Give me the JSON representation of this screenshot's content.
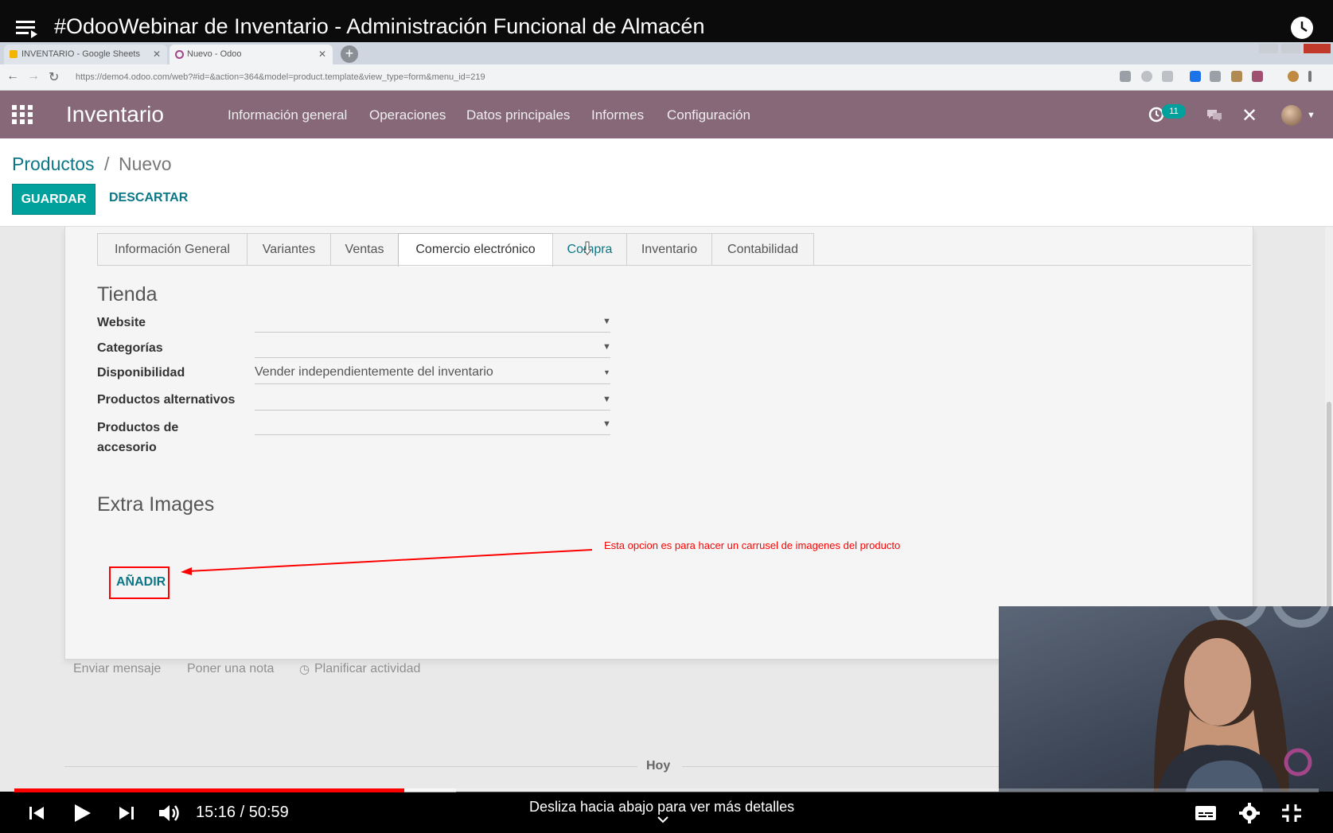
{
  "video": {
    "title": "#OdooWebinar de Inventario - Administración Funcional de Almacén",
    "time_current": "15:16",
    "time_separator": " / ",
    "time_total": "50:59",
    "progress_fraction": 0.299,
    "hint": "Desliza hacia abajo para ver más detalles"
  },
  "browser": {
    "tabs": [
      {
        "label": "INVENTARIO - Google Sheets"
      },
      {
        "label": "Nuevo - Odoo"
      }
    ],
    "url": "https://demo4.odoo.com/web?#id=&action=364&model=product.template&view_type=form&menu_id=219"
  },
  "odoo": {
    "app_name": "Inventario",
    "menu": [
      "Información general",
      "Operaciones",
      "Datos principales",
      "Informes",
      "Configuración"
    ],
    "activity_count": "11",
    "breadcrumb": {
      "parent": "Productos",
      "separator": "/",
      "current": "Nuevo"
    },
    "buttons": {
      "save": "GUARDAR",
      "discard": "DESCARTAR",
      "add": "AÑADIR"
    },
    "tabs": [
      "Información General",
      "Variantes",
      "Ventas",
      "Comercio electrónico",
      "Compra",
      "Inventario",
      "Contabilidad"
    ],
    "active_tab": "Comercio electrónico",
    "shop": {
      "title": "Tienda",
      "fields": [
        {
          "label": "Website",
          "value": ""
        },
        {
          "label": "Categorías",
          "value": ""
        },
        {
          "label": "Disponibilidad",
          "value": "Vender independientemente del inventario"
        },
        {
          "label": "Productos alternativos",
          "value": ""
        },
        {
          "label": "Productos de accesorio",
          "value": ""
        }
      ]
    },
    "extra_images_title": "Extra Images",
    "chatter": {
      "send": "Enviar mensaje",
      "note": "Poner una nota",
      "activity": "Planificar actividad",
      "today": "Hoy"
    }
  },
  "annotation": {
    "text": "Esta opcion es para hacer un carrusel de imagenes del producto",
    "color": "#ff0000"
  },
  "colors": {
    "odoo_nav": "#876879",
    "odoo_accent": "#00a09d",
    "link": "#0b7786",
    "yt_red": "#ff0000"
  }
}
